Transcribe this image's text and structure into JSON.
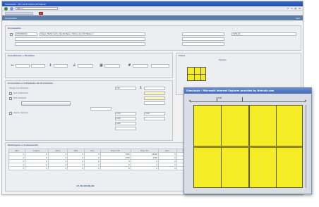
{
  "window": {
    "title": "Simulação - Microsoft Internet Explorer",
    "url": "http://..."
  },
  "appbar": {
    "left_label": "Orçamento",
    "right_label": "Sair"
  },
  "header_panel": {
    "title": "Orçamento",
    "code": "CTC2000211",
    "description": "Diego, Martin Isidro, Benita Basso, Tortura de 4,30 Tabela 2",
    "right_value": "1050,00"
  },
  "quantity_panel": {
    "title": "Quantidade e Medidas"
  },
  "options_panel": {
    "title": "Acessórios e Instalação de Acessórios",
    "items": [
      "Fixação Com Parafusos",
      "Sem Acabamento",
      "Sem Instalação",
      "Cliente / Retirada"
    ],
    "values": [
      "100",
      "0,00",
      "0,00",
      "0,00",
      "0,00"
    ]
  },
  "photo_label": "Fotos",
  "photo_label2": "Detalhes",
  "bottom_panel": {
    "title": "Montagem e Acabamento",
    "headers": [
      "Item",
      "Largura",
      "Altura",
      "Qtde",
      "Unid",
      "Preço Unit.",
      "Preço Tot.",
      "Desc.",
      "Total"
    ],
    "rows": [
      [
        "1",
        "0",
        "0",
        "0",
        "0",
        "7050",
        "20000",
        "0",
        "0"
      ],
      [
        "2",
        "0",
        "0",
        "0",
        "0",
        "2750",
        "2750",
        "0",
        "0"
      ],
      [
        "3",
        "0",
        "0",
        "0",
        "0",
        "0",
        "0",
        "0",
        "0"
      ],
      [
        "4",
        "0",
        "0",
        "0",
        "0",
        "0",
        "0",
        "0",
        "0"
      ],
      [
        "5",
        "0",
        "0",
        "0",
        "0",
        "0",
        "0",
        "0",
        "0"
      ]
    ],
    "footer": "17.30.00.00.00"
  },
  "popup": {
    "title": "Simulação - Microsoft Internet Explorer provided by Netvale.com",
    "ruler_label": "100"
  },
  "colors": {
    "glass": "#f4ec25",
    "frame": "#5e5a1a"
  }
}
